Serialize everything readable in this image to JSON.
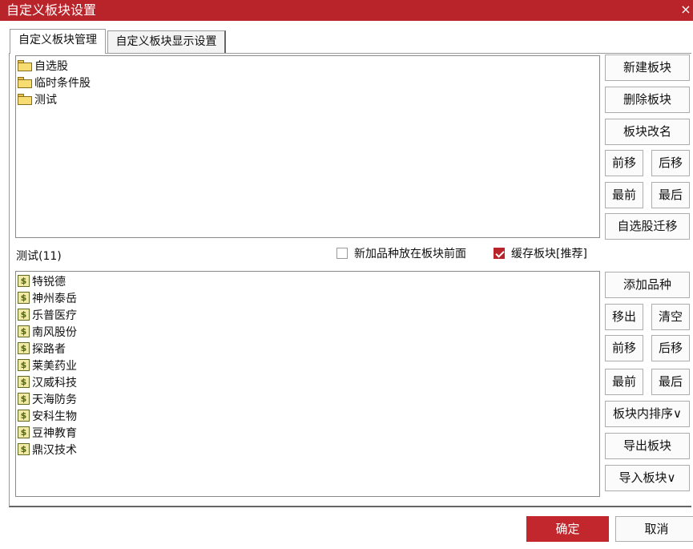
{
  "window": {
    "title": "自定义板块设置",
    "close_glyph": "×"
  },
  "tabs": [
    {
      "label": "自定义板块管理",
      "active": true
    },
    {
      "label": "自定义板块显示设置",
      "active": false
    }
  ],
  "blocks": [
    {
      "label": "自选股",
      "icon": "folder-icon"
    },
    {
      "label": "临时条件股",
      "icon": "folder-icon"
    },
    {
      "label": "测试",
      "icon": "folder-icon"
    }
  ],
  "block_buttons": {
    "new": "新建板块",
    "delete": "删除板块",
    "rename": "板块改名",
    "move_up": "前移",
    "move_down": "后移",
    "move_first": "最前",
    "move_last": "最后",
    "migrate": "自选股迁移"
  },
  "current_block": {
    "label": "测试(11)"
  },
  "options": {
    "add_front": {
      "label": "新加品种放在板块前面",
      "checked": false
    },
    "cache": {
      "label": "缓存板块[推荐]",
      "checked": true
    }
  },
  "stocks": [
    {
      "label": "特锐德",
      "icon": "stock-icon"
    },
    {
      "label": "神州泰岳",
      "icon": "stock-icon"
    },
    {
      "label": "乐普医疗",
      "icon": "stock-icon"
    },
    {
      "label": "南风股份",
      "icon": "stock-icon"
    },
    {
      "label": "探路者",
      "icon": "stock-icon"
    },
    {
      "label": "莱美药业",
      "icon": "stock-icon"
    },
    {
      "label": "汉威科技",
      "icon": "stock-icon"
    },
    {
      "label": "天海防务",
      "icon": "stock-icon"
    },
    {
      "label": "安科生物",
      "icon": "stock-icon"
    },
    {
      "label": "豆神教育",
      "icon": "stock-icon"
    },
    {
      "label": "鼎汉技术",
      "icon": "stock-icon"
    }
  ],
  "stock_icon_glyph": "$",
  "stock_buttons": {
    "add": "添加品种",
    "remove": "移出",
    "clear": "清空",
    "move_up": "前移",
    "move_down": "后移",
    "move_first": "最前",
    "move_last": "最后",
    "sort": "板块内排序∨",
    "export": "导出板块",
    "import": "导入板块∨"
  },
  "footer": {
    "ok": "确定",
    "cancel": "取消"
  },
  "colors": {
    "accent": "#b8242a",
    "ok_button": "#c1272d"
  }
}
